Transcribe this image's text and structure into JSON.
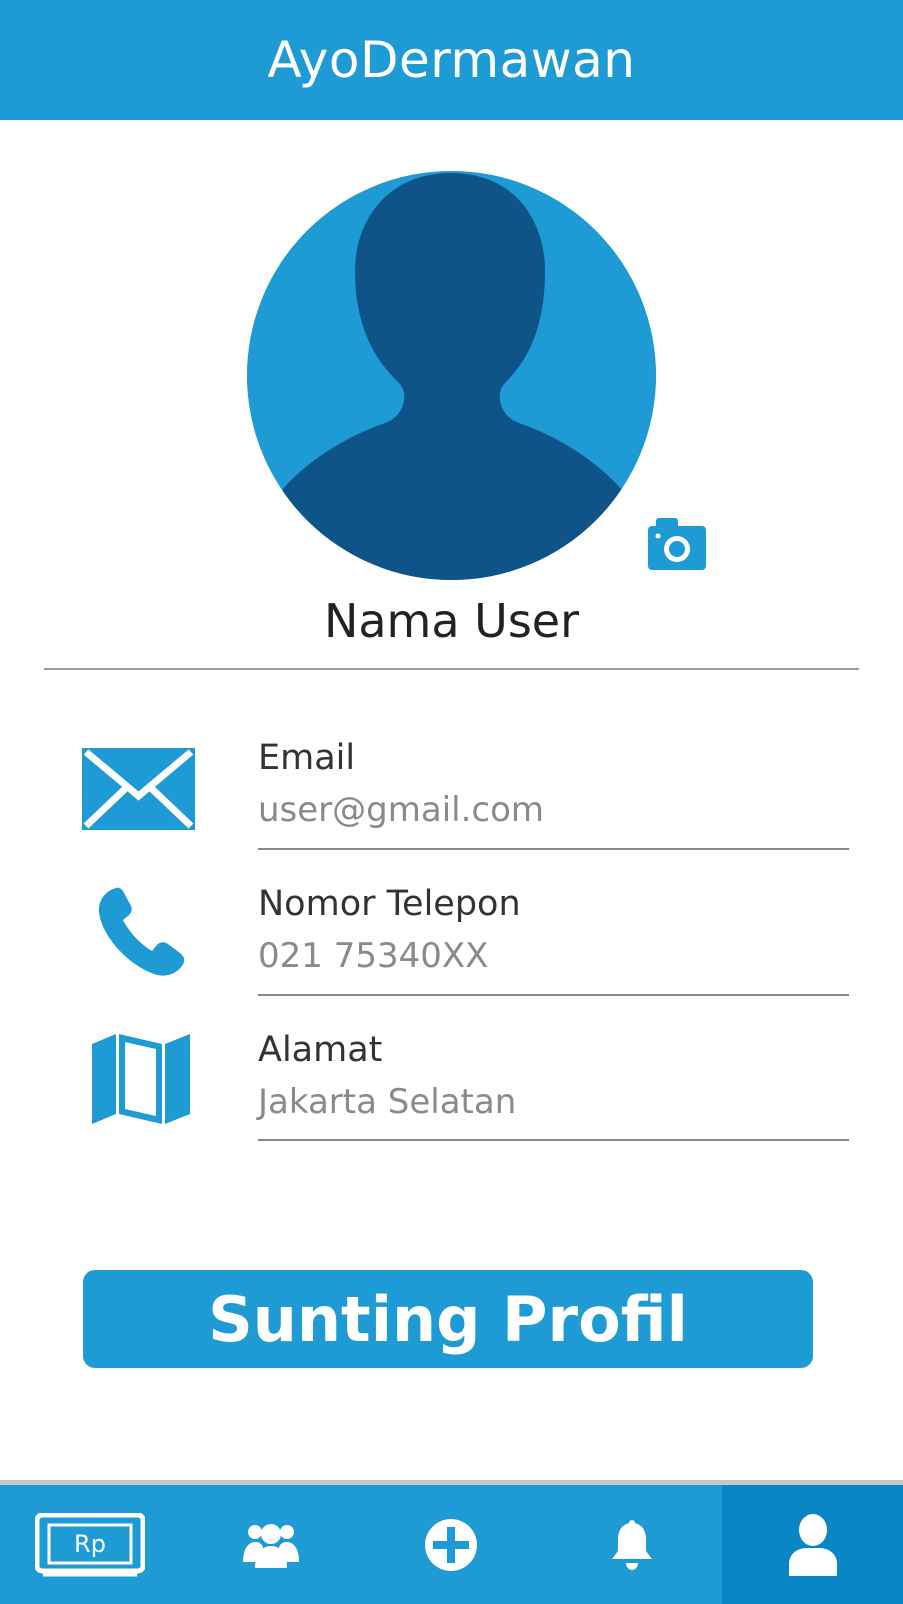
{
  "header": {
    "title": "AyoDermawan"
  },
  "profile": {
    "name": "Nama User"
  },
  "fields": [
    {
      "label": "Email",
      "value": "user@gmail.com",
      "icon": "envelope-icon"
    },
    {
      "label": "Nomor Telepon",
      "value": "021 75340XX",
      "icon": "phone-icon"
    },
    {
      "label": "Alamat",
      "value": "Jakarta Selatan",
      "icon": "map-icon"
    }
  ],
  "actions": {
    "edit_label": "Sunting Profil"
  },
  "nav": {
    "donate_badge": "Rp",
    "items": [
      "donation-icon",
      "community-icon",
      "add-icon",
      "bell-icon",
      "profile-icon"
    ],
    "active": "profile-icon"
  },
  "colors": {
    "primary": "#1e9bd5",
    "avatar_dark": "#0e5488",
    "nav_active": "#0a86c6"
  }
}
